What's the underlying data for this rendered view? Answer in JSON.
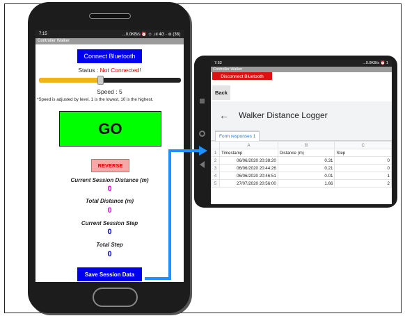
{
  "phone1": {
    "status_time": "7:15",
    "status_right": "...0.0KB/s ⏰ ☺ .ııl 4G · ⊜ (38)",
    "app_title": "Controller Walker",
    "connect_button": "Connect Bluetooth",
    "status_label": "Status :",
    "status_value": "Not Connected!",
    "speed_label": "Speed :",
    "speed_value": "5",
    "speed_level_fraction": 0.43,
    "speed_note": "*Speed is adjusted by level. 1 is the lowest, 10 is the highest.",
    "go_button": "GO",
    "reverse_button": "REVERSE",
    "current_session_distance_label": "Current Session Distance (m)",
    "current_session_distance_value": "0",
    "total_distance_label": "Total Distance (m)",
    "total_distance_value": "0",
    "current_session_step_label": "Current Session Step",
    "current_session_step_value": "0",
    "total_step_label": "Total Step",
    "total_step_value": "0",
    "save_button": "Save Session Data"
  },
  "phone2": {
    "status_time": "7:53",
    "status_right": "...0.0KB/s ⏰ 1",
    "app_title": "Controller Walker",
    "disconnect_button": "Disconnect Bluetooth",
    "back_button": "Back",
    "sheet_title": "Walker Distance Logger",
    "tab_label": "Form responses 1",
    "column_headers": [
      "A",
      "B",
      "C"
    ],
    "rows": [
      {
        "n": "1",
        "a": "Timestamp",
        "b": "Distance (m)",
        "c": "Step"
      },
      {
        "n": "2",
        "a": "06/06/2020 20:38:20",
        "b": "0.31",
        "c": "0"
      },
      {
        "n": "3",
        "a": "06/06/2020 20:44:26",
        "b": "0.21",
        "c": "0"
      },
      {
        "n": "4",
        "a": "06/06/2020 20:46:51",
        "b": "0.01",
        "c": "1"
      },
      {
        "n": "5",
        "a": "27/07/2020 20:56:00",
        "b": "1.66",
        "c": "2"
      }
    ]
  },
  "colors": {
    "button_blue": "#0000ee",
    "go_green": "#00ff00",
    "status_red": "#e00000",
    "metric_pink": "#e600e6",
    "metric_blue": "#0000cc",
    "connector": "#1e90ff"
  }
}
